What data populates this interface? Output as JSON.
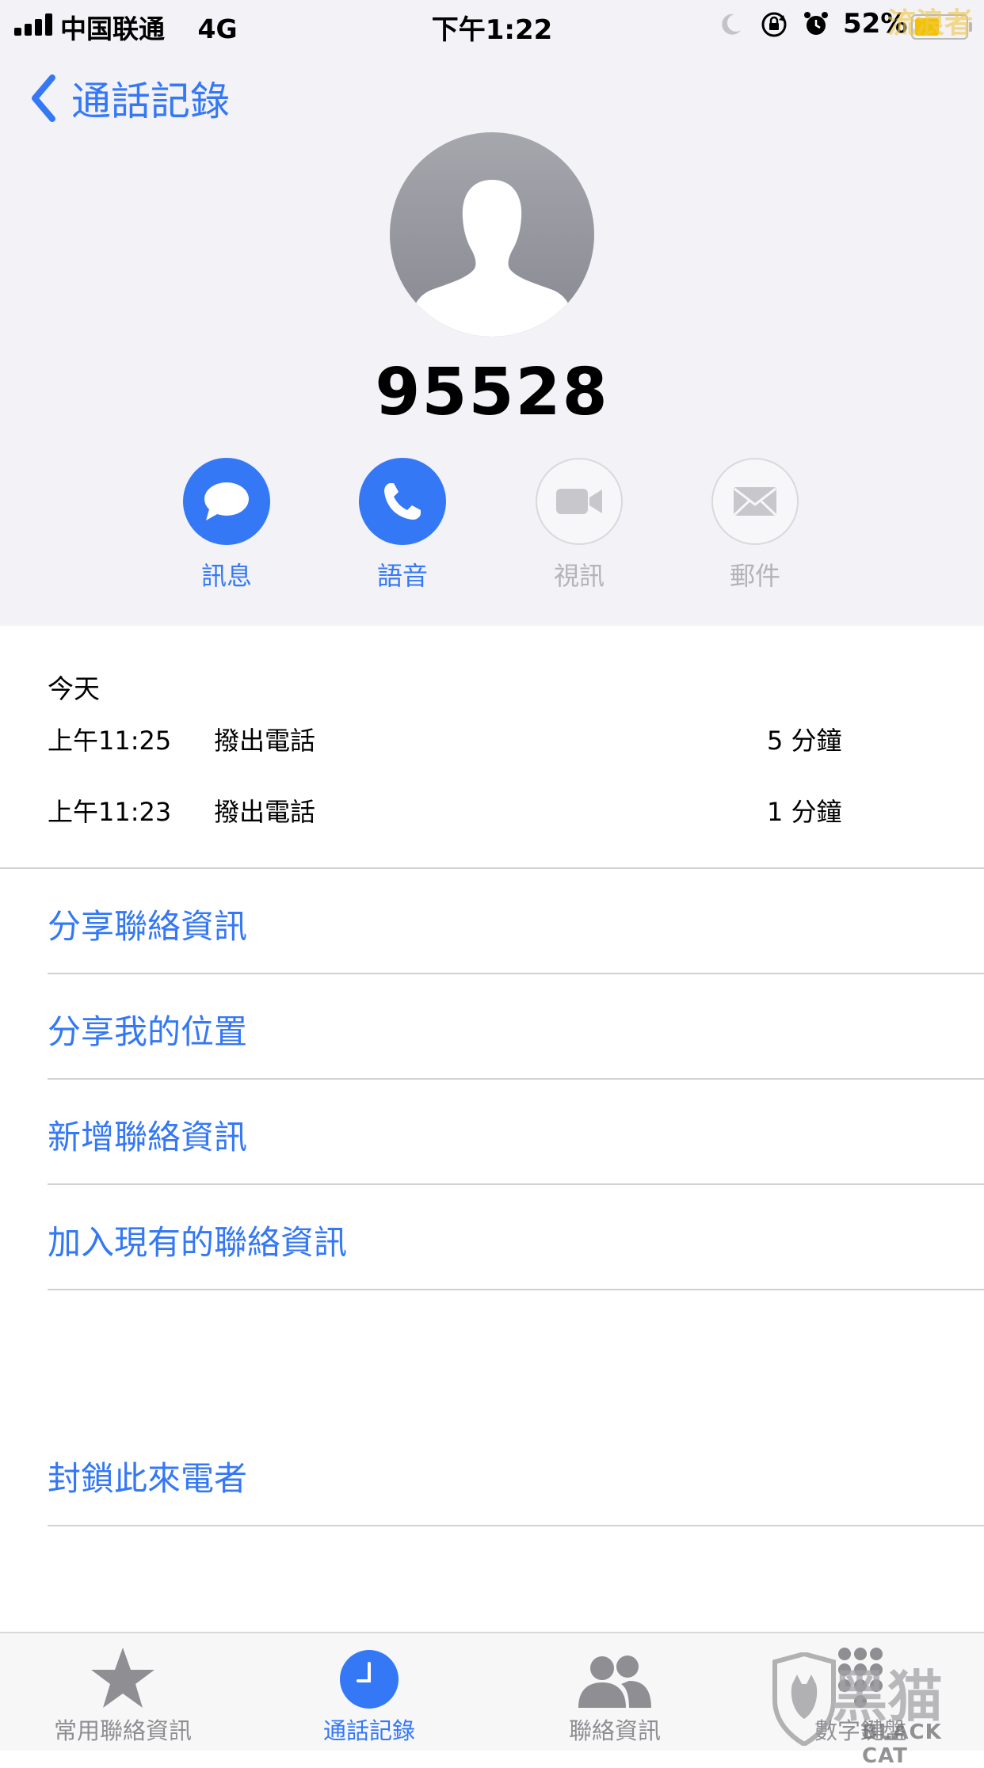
{
  "status_bar": {
    "carrier": "中国联通",
    "network": "4G",
    "time": "下午1:22",
    "battery_percent": "52%",
    "battery_level": 0.52,
    "icons": [
      "moon-icon",
      "rotation-lock-icon",
      "alarm-icon"
    ],
    "watermark": "流浪者"
  },
  "nav": {
    "back_label": "通話記錄"
  },
  "contact": {
    "number": "95528"
  },
  "actions": [
    {
      "label": "訊息",
      "icon": "message-icon",
      "enabled": true
    },
    {
      "label": "語音",
      "icon": "phone-icon",
      "enabled": true
    },
    {
      "label": "視訊",
      "icon": "video-icon",
      "enabled": false
    },
    {
      "label": "郵件",
      "icon": "mail-icon",
      "enabled": false
    }
  ],
  "history": {
    "date_label": "今天",
    "calls": [
      {
        "time": "上午11:25",
        "kind": "撥出電話",
        "duration": "5 分鐘"
      },
      {
        "time": "上午11:23",
        "kind": "撥出電話",
        "duration": "1 分鐘"
      }
    ]
  },
  "options": [
    {
      "label": "分享聯絡資訊"
    },
    {
      "label": "分享我的位置"
    },
    {
      "label": "新增聯絡資訊"
    },
    {
      "label": "加入現有的聯絡資訊"
    }
  ],
  "block": {
    "label": "封鎖此來電者"
  },
  "tabbar": [
    {
      "label": "常用聯絡資訊",
      "icon": "star-icon",
      "active": false
    },
    {
      "label": "通話記錄",
      "icon": "clock-icon",
      "active": true
    },
    {
      "label": "聯絡資訊",
      "icon": "contacts-icon",
      "active": false
    },
    {
      "label": "數字鍵盤",
      "icon": "keypad-icon",
      "active": false
    }
  ],
  "watermark": {
    "cn": "黑猫",
    "en": "BLACK CAT"
  },
  "colors": {
    "accent": "#3478f6",
    "header_background": "#f2f2f7",
    "disabled": "#b4b4b8",
    "separator": "#d1d1d6"
  }
}
